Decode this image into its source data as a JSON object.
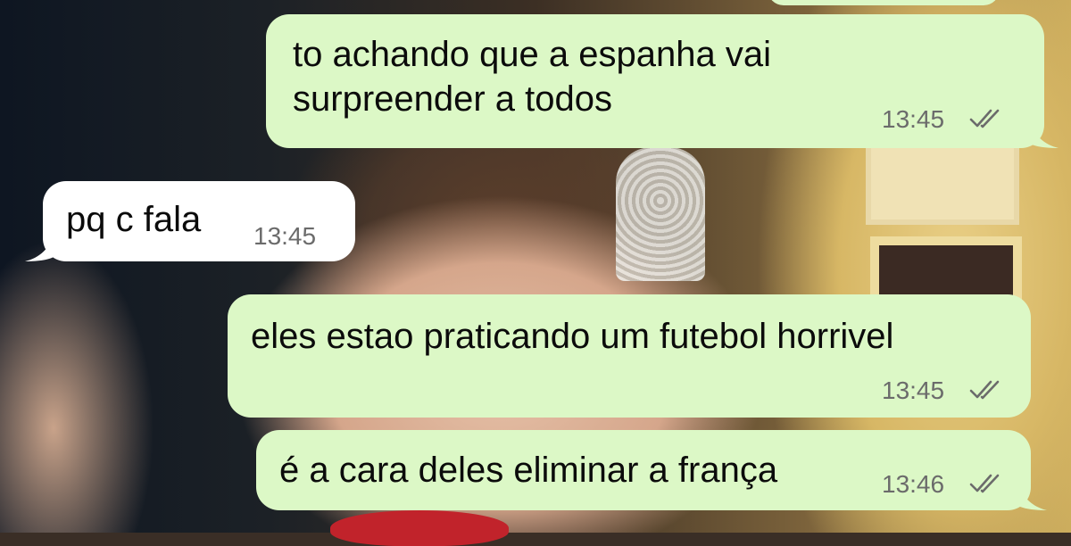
{
  "messages": [
    {
      "direction": "outgoing",
      "text": "to achando que a espanha vai\nsurpreender a todos",
      "time": "13:45",
      "read": true
    },
    {
      "direction": "incoming",
      "text": "pq c fala",
      "time": "13:45"
    },
    {
      "direction": "outgoing",
      "text": "eles estao praticando um futebol horrivel",
      "time": "13:45",
      "read": true
    },
    {
      "direction": "outgoing",
      "text": "é a cara deles eliminar a frança",
      "time": "13:46",
      "read": true
    }
  ],
  "colors": {
    "outgoing_bubble": "#dcf8c6",
    "incoming_bubble": "#ffffff",
    "timestamp": "#6b6b6b",
    "read_ticks": "#6b6b6b"
  },
  "icons": {
    "read_receipt": "double-check-icon"
  }
}
